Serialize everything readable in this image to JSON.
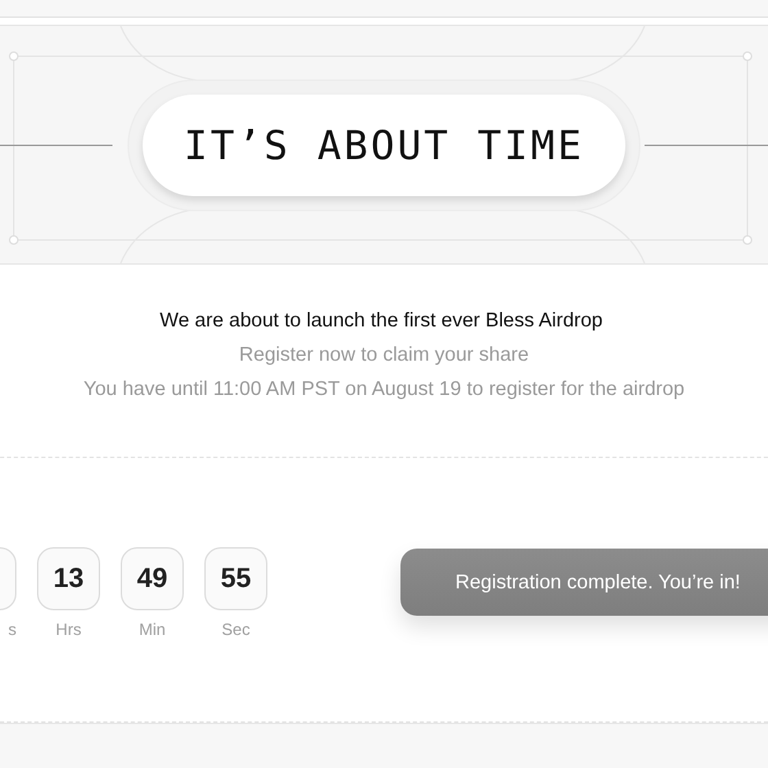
{
  "banner": {
    "title": "IT’S ABOUT TIME"
  },
  "message": {
    "headline": "We are about to launch the first ever Bless Airdrop",
    "subline": "Register now to claim your share",
    "deadline": "You have until 11:00 AM PST on August 19 to register for the airdrop"
  },
  "countdown": [
    {
      "label": "s"
    },
    {
      "value": "13",
      "label": "Hrs"
    },
    {
      "value": "49",
      "label": "Min"
    },
    {
      "value": "55",
      "label": "Sec"
    }
  ],
  "toast": {
    "text": "Registration complete. You’re in!"
  }
}
